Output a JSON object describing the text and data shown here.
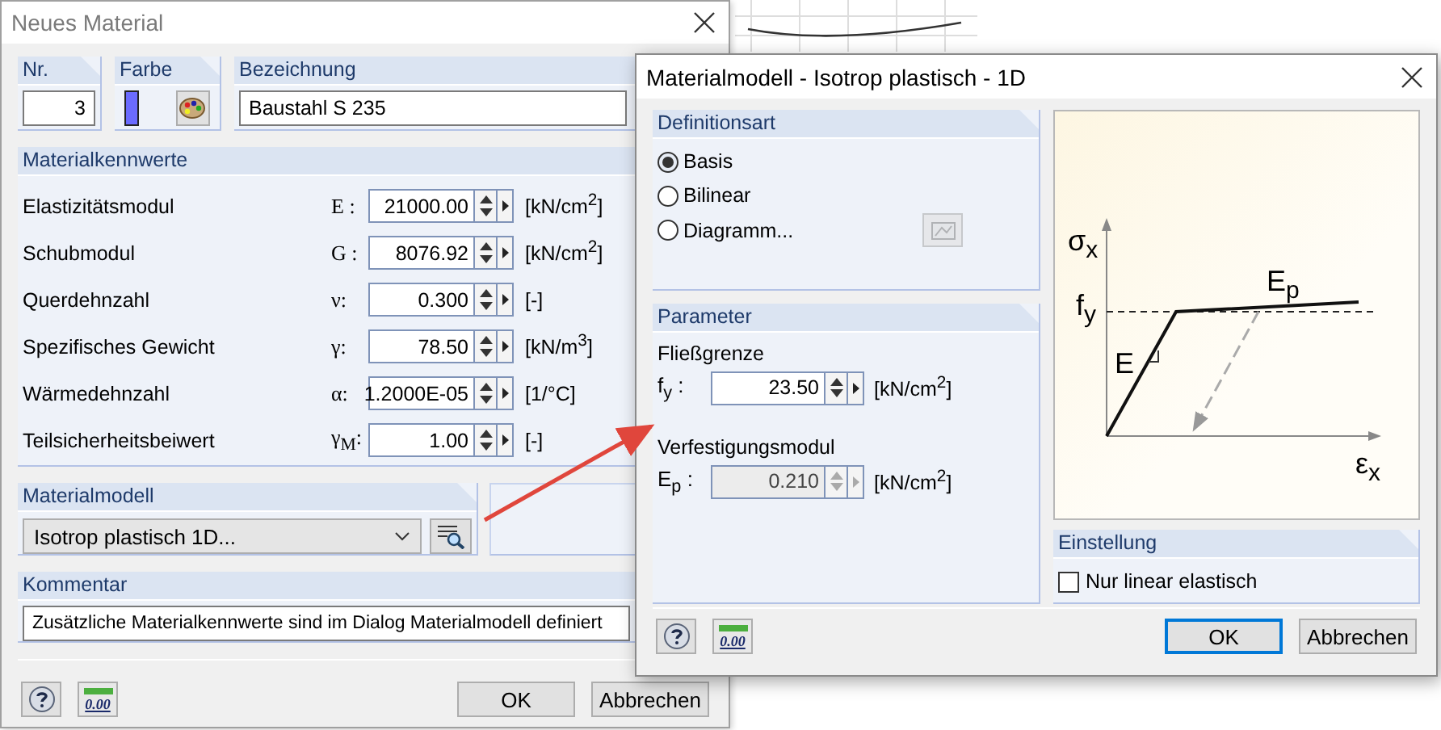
{
  "main_dialog": {
    "title": "Neues Material",
    "number": {
      "label": "Nr.",
      "value": "3"
    },
    "color": {
      "label": "Farbe"
    },
    "designation": {
      "label": "Bezeichnung",
      "value": "Baustahl S 235"
    },
    "properties": {
      "title": "Materialkennwerte",
      "rows": [
        {
          "label": "Elastizitätsmodul",
          "symbol": "E :",
          "value": "21000.00",
          "unit": "[kN/cm$^{2}$]"
        },
        {
          "label": "Schubmodul",
          "symbol": "G :",
          "value": "8076.92",
          "unit": "[kN/cm$^{2}$]"
        },
        {
          "label": "Querdehnzahl",
          "symbol": "ν:",
          "value": "0.300",
          "unit": "[-]"
        },
        {
          "label": "Spezifisches Gewicht",
          "symbol": "γ:",
          "value": "78.50",
          "unit": "[kN/m$^{3}$]"
        },
        {
          "label": "Wärmedehnzahl",
          "symbol": "α:",
          "value": "1.2000E-05",
          "unit": "[1/°C]"
        },
        {
          "label": "Teilsicherheitsbeiwert",
          "symbol": "γ$_{M}$:",
          "value": "1.00",
          "unit": "[-]"
        }
      ]
    },
    "material_model": {
      "title": "Materialmodell",
      "value": "Isotrop plastisch 1D..."
    },
    "comment": {
      "title": "Kommentar",
      "value": "Zusätzliche Materialkennwerte sind im Dialog Materialmodell definiert"
    },
    "decimal_icon": "0.00",
    "buttons": [
      {
        "label": "OK",
        "focused": false
      },
      {
        "label": "Abbrechen",
        "focused": false
      }
    ]
  },
  "model_dialog": {
    "title": "Materialmodell - Isotrop plastisch - 1D",
    "definition": {
      "title": "Definitionsart",
      "options": [
        {
          "label": "Basis",
          "selected": true
        },
        {
          "label": "Bilinear",
          "selected": false
        },
        {
          "label": "Diagramm...",
          "selected": false
        }
      ]
    },
    "parameters": {
      "title": "Parameter",
      "fields": [
        {
          "label": "Fließgrenze",
          "symbol": "f$_{y}$ :",
          "value": "23.50",
          "unit": "[kN/cm$^{2}$]",
          "disabled": false
        },
        {
          "label": "Verfestigungsmodul",
          "symbol": "E$_{p}$ :",
          "value": "0.210",
          "unit": "[kN/cm$^{2}$]",
          "disabled": true
        }
      ]
    },
    "diagram": {
      "stress_label": "σ$_{x}$",
      "yield_label": "f$_{y}$",
      "elastic_label": "E",
      "plastic_label": "E$_{p}$",
      "strain_label": "ε$_{x}$"
    },
    "setting": {
      "title": "Einstellung",
      "checkbox": {
        "label": "Nur linear elastisch",
        "checked": false
      }
    },
    "decimal_icon": "0.00",
    "buttons": [
      {
        "label": "OK",
        "focused": true
      },
      {
        "label": "Abbrechen",
        "focused": false
      }
    ]
  }
}
